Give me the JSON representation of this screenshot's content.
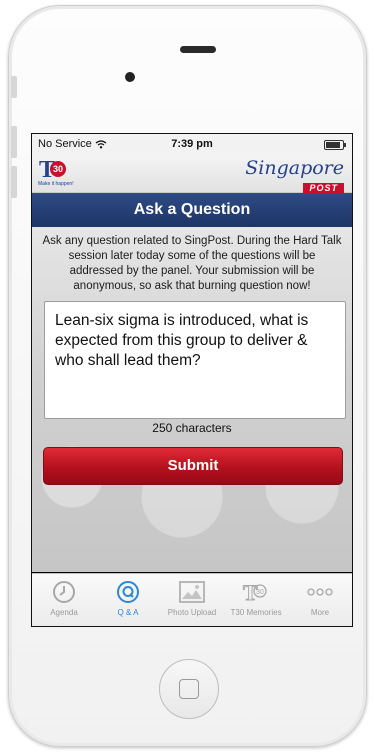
{
  "status": {
    "carrier": "No Service",
    "time": "7:39 pm"
  },
  "brand": {
    "left_logo_letters": "T",
    "left_logo_number": "30",
    "left_logo_tagline": "Make it happen!",
    "right_logo_script": "Singapore",
    "right_logo_post": "POST"
  },
  "screen_title": "Ask a Question",
  "intro_text": "Ask any question related to SingPost. During the Hard Talk session later today some of the questions will be addressed by the panel. Your submission will be anonymous, so ask that burning question now!",
  "question_text": "Lean-six sigma is introduced, what is expected from this group to deliver & who shall lead them?",
  "characters_remaining": "250 characters",
  "submit_label": "Submit",
  "tabs": [
    {
      "label": "Agenda",
      "icon": "clock-icon",
      "active": false
    },
    {
      "label": "Q & A",
      "icon": "q-circle-icon",
      "active": true
    },
    {
      "label": "Photo Upload",
      "icon": "photo-icon",
      "active": false
    },
    {
      "label": "T30 Memories",
      "icon": "t30-icon",
      "active": false
    },
    {
      "label": "More",
      "icon": "more-dots-icon",
      "active": false
    }
  ],
  "colors": {
    "nav_blue": "#24418c",
    "submit_red": "#b4111e",
    "active_tab_blue": "#2e86d6"
  }
}
